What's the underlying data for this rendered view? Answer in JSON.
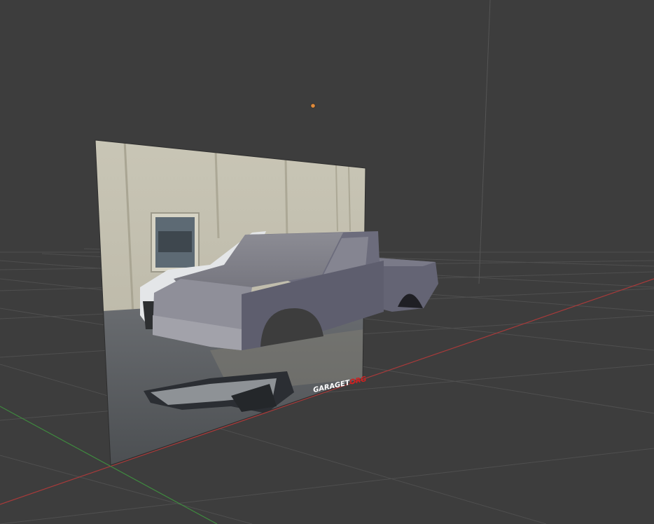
{
  "viewport": {
    "background": "#3d3d3d",
    "grid_color": "#4f4f4f",
    "x_axis_color": "#a83a3a",
    "y_axis_color": "#3f8a3f",
    "z_axis_color": "#555555",
    "light_color": "#e08a3a",
    "light_icon": "lamp-light-icon"
  },
  "reference_image": {
    "watermark_main": "GARAGET",
    "watermark_suffix": "ORG",
    "watermark_main_color": "#ffffff",
    "watermark_suffix_color": "#d02020"
  },
  "car_model": {
    "body_color": "#6e6e7e",
    "top_color": "#868690",
    "side_color": "#5a5a6a"
  }
}
